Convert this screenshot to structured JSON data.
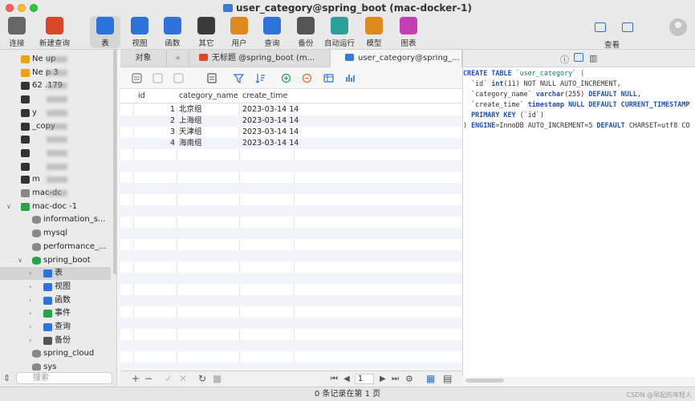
{
  "window": {
    "title": "user_category@spring_boot (mac-docker-1)"
  },
  "toolbar": {
    "items": [
      {
        "label": "连接",
        "icon": "plug-icon",
        "color": "#666666"
      },
      {
        "label": "新建查询",
        "icon": "new-query-icon",
        "color": "#d9472b"
      },
      {
        "label": "表",
        "icon": "table-icon",
        "color": "#2f72d9"
      },
      {
        "label": "视图",
        "icon": "view-icon",
        "color": "#2f72d9"
      },
      {
        "label": "函数",
        "icon": "function-icon",
        "color": "#2f72d9"
      },
      {
        "label": "其它",
        "icon": "tools-icon",
        "color": "#3a3a3a"
      },
      {
        "label": "用户",
        "icon": "user-icon",
        "color": "#e08a1e"
      },
      {
        "label": "查询",
        "icon": "query-icon",
        "color": "#2f72d9"
      },
      {
        "label": "备份",
        "icon": "backup-icon",
        "color": "#555555"
      },
      {
        "label": "自动运行",
        "icon": "robot-icon",
        "color": "#2aa198"
      },
      {
        "label": "模型",
        "icon": "model-icon",
        "color": "#e08a1e"
      },
      {
        "label": "图表",
        "icon": "chart-icon",
        "color": "#c13fb0"
      }
    ],
    "view_label": "查看"
  },
  "sidebar": {
    "items": [
      {
        "label": "Ne            up",
        "indent": 0
      },
      {
        "label": "Ne             p 3",
        "indent": 0
      },
      {
        "label": "62         .179",
        "indent": 0
      },
      {
        "label": "",
        "indent": 0
      },
      {
        "label": "                y",
        "indent": 0
      },
      {
        "label": "             _copy",
        "indent": 0
      },
      {
        "label": "",
        "indent": 0
      },
      {
        "label": "",
        "indent": 0
      },
      {
        "label": "",
        "indent": 0
      },
      {
        "label": "m",
        "indent": 0
      },
      {
        "label": "mac-dc",
        "indent": 0
      },
      {
        "label": "mac-doc      -1",
        "indent": 0
      },
      {
        "label": "information_s...",
        "indent": 1
      },
      {
        "label": "mysql",
        "indent": 1
      },
      {
        "label": "performance_...",
        "indent": 1
      },
      {
        "label": "spring_boot",
        "indent": 1
      },
      {
        "label": "表",
        "indent": 2
      },
      {
        "label": "视图",
        "indent": 2
      },
      {
        "label": "函数",
        "indent": 2
      },
      {
        "label": "事件",
        "indent": 2
      },
      {
        "label": "查询",
        "indent": 2
      },
      {
        "label": "备份",
        "indent": 2
      },
      {
        "label": "spring_cloud",
        "indent": 1
      },
      {
        "label": "sys",
        "indent": 1
      }
    ],
    "search_placeholder": "搜索"
  },
  "tabs": {
    "objects": "对象",
    "items": [
      {
        "label": "无标题 @spring_boot (m..."
      },
      {
        "label": "user_category@spring_..."
      }
    ]
  },
  "grid": {
    "columns": [
      "id",
      "category_name",
      "create_time"
    ],
    "rows": [
      {
        "id": "1",
        "category_name": "北京组",
        "create_time": "2023-03-14 14"
      },
      {
        "id": "2",
        "category_name": "上海组",
        "create_time": "2023-03-14 14"
      },
      {
        "id": "3",
        "category_name": "天津组",
        "create_time": "2023-03-14 14"
      },
      {
        "id": "4",
        "category_name": "海南组",
        "create_time": "2023-03-14 14"
      }
    ],
    "page": "1"
  },
  "ddl": {
    "l1_kw": "CREATE TABLE",
    "l1_name": " `user_category` (",
    "l2_name": "  `id` ",
    "l2_type": "int",
    "l2_rest": "(11) NOT NULL AUTO_INCREMENT,",
    "l3_name": "  `category_name` ",
    "l3_type": "varchar",
    "l3_rest": "(255) ",
    "l3_kw": "DEFAULT NULL",
    "l4_name": "  `create_time` ",
    "l4_type": "timestamp",
    "l4_rest": " ",
    "l4_kw": "NULL DEFAULT CURRENT_TIMESTAMP",
    "l5_kw": "  PRIMARY KEY",
    "l5_rest": " (`id`)",
    "l6_rest": ") ",
    "l6_kw": "ENGINE",
    "l6_eq": "=InnoDB AUTO_INCREMENT=5 ",
    "l6_kw2": "DEFAULT",
    "l6_tail": " CHARSET=utf8 CO"
  },
  "status": {
    "text": "0 条记录在第 1 页",
    "watermark": "CSDN @早起的年轻人"
  }
}
